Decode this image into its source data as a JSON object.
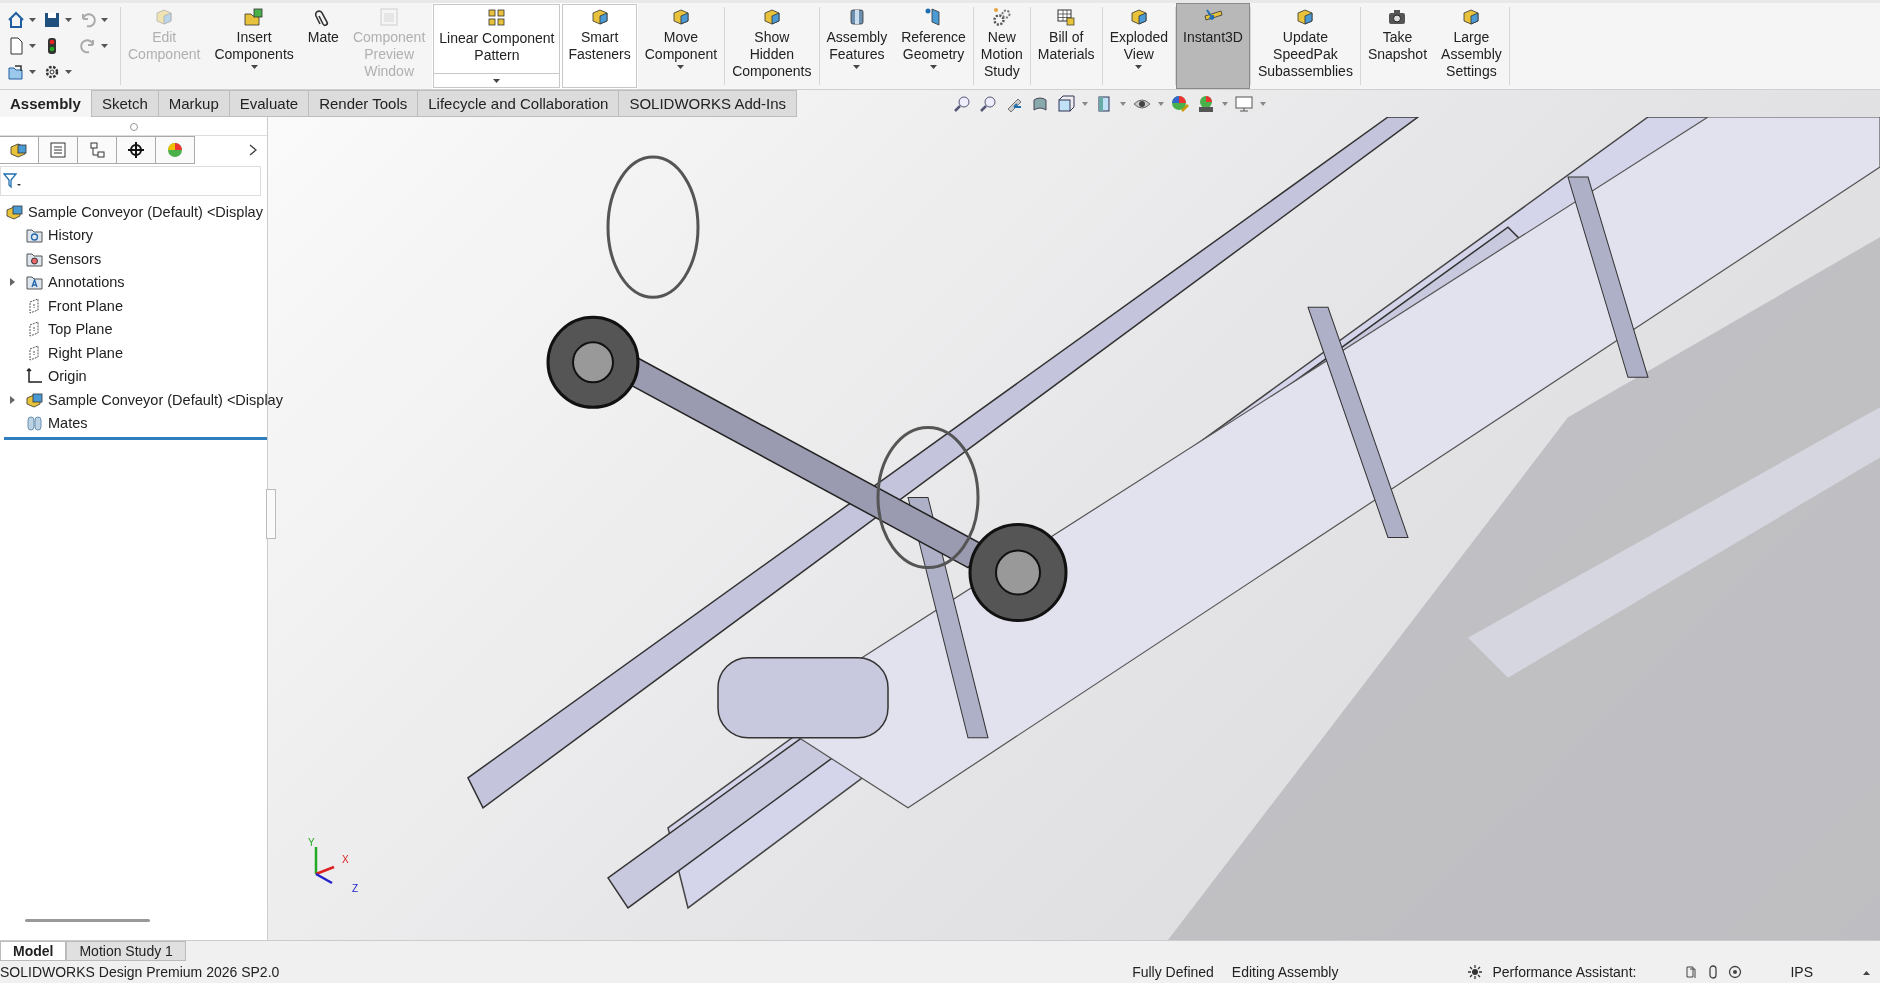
{
  "ribbon": {
    "groups": [
      [
        {
          "lines": [
            "Edit",
            "Component"
          ],
          "kind": "large",
          "dropdown": false,
          "disabled": true,
          "selected": false,
          "framed": false
        },
        {
          "lines": [
            "Insert",
            "Components"
          ],
          "kind": "large",
          "dropdown": true,
          "disabled": false,
          "selected": false,
          "framed": false
        },
        {
          "lines": [
            "Mate"
          ],
          "kind": "large",
          "dropdown": false,
          "disabled": false,
          "selected": false,
          "framed": false
        },
        {
          "lines": [
            "Component",
            "Preview",
            "Window"
          ],
          "kind": "large",
          "dropdown": false,
          "disabled": true,
          "selected": false,
          "framed": false
        },
        {
          "lines": [
            "Linear Component",
            "Pattern"
          ],
          "kind": "split",
          "dropdown": true,
          "disabled": false,
          "selected": false,
          "framed": true
        },
        {
          "lines": [
            "Smart",
            "Fasteners"
          ],
          "kind": "large",
          "dropdown": false,
          "disabled": false,
          "selected": false,
          "framed": true
        },
        {
          "lines": [
            "Move",
            "Component"
          ],
          "kind": "large",
          "dropdown": true,
          "disabled": false,
          "selected": false,
          "framed": false
        }
      ],
      [
        {
          "lines": [
            "Show",
            "Hidden",
            "Components"
          ],
          "kind": "large",
          "dropdown": false,
          "disabled": false,
          "selected": false,
          "framed": false
        }
      ],
      [
        {
          "lines": [
            "Assembly",
            "Features"
          ],
          "kind": "large",
          "dropdown": true,
          "disabled": false,
          "selected": false,
          "framed": false
        },
        {
          "lines": [
            "Reference",
            "Geometry"
          ],
          "kind": "large",
          "dropdown": true,
          "disabled": false,
          "selected": false,
          "framed": false
        }
      ],
      [
        {
          "lines": [
            "New",
            "Motion",
            "Study"
          ],
          "kind": "large",
          "dropdown": false,
          "disabled": false,
          "selected": false,
          "framed": false
        }
      ],
      [
        {
          "lines": [
            "Bill of",
            "Materials"
          ],
          "kind": "large",
          "dropdown": false,
          "disabled": false,
          "selected": false,
          "framed": false
        }
      ],
      [
        {
          "lines": [
            "Exploded",
            "View"
          ],
          "kind": "large",
          "dropdown": true,
          "disabled": false,
          "selected": false,
          "framed": false
        }
      ],
      [
        {
          "lines": [
            "Instant3D"
          ],
          "kind": "large",
          "dropdown": false,
          "disabled": false,
          "selected": true,
          "framed": false
        }
      ],
      [
        {
          "lines": [
            "Update",
            "SpeedPak",
            "Subassemblies"
          ],
          "kind": "large",
          "dropdown": false,
          "disabled": false,
          "selected": false,
          "framed": false
        }
      ],
      [
        {
          "lines": [
            "Take",
            "Snapshot"
          ],
          "kind": "large",
          "dropdown": false,
          "disabled": false,
          "selected": false,
          "framed": false
        },
        {
          "lines": [
            "Large",
            "Assembly",
            "Settings"
          ],
          "kind": "large",
          "dropdown": false,
          "disabled": false,
          "selected": false,
          "framed": false
        }
      ]
    ]
  },
  "tabs": [
    {
      "label": "Assembly",
      "selected": true
    },
    {
      "label": "Sketch",
      "selected": false
    },
    {
      "label": "Markup",
      "selected": false
    },
    {
      "label": "Evaluate",
      "selected": false
    },
    {
      "label": "Render Tools",
      "selected": false
    },
    {
      "label": "Lifecycle and Collaboration",
      "selected": false
    },
    {
      "label": "SOLIDWORKS Add-Ins",
      "selected": false
    }
  ],
  "tree": {
    "label": "Sample Conveyor (Default) <Display",
    "kind": "assembly",
    "children": [
      {
        "label": "History",
        "kind": "history",
        "expandable": false
      },
      {
        "label": "Sensors",
        "kind": "sensors",
        "expandable": false
      },
      {
        "label": "Annotations",
        "kind": "annotations",
        "expandable": true
      },
      {
        "label": "Front Plane",
        "kind": "plane",
        "expandable": false
      },
      {
        "label": "Top Plane",
        "kind": "plane",
        "expandable": false
      },
      {
        "label": "Right Plane",
        "kind": "plane",
        "expandable": false
      },
      {
        "label": "Origin",
        "kind": "origin",
        "expandable": false
      },
      {
        "label": "Sample Conveyor (Default) <Display",
        "kind": "assembly",
        "expandable": true
      },
      {
        "label": "Mates",
        "kind": "mates",
        "expandable": false
      }
    ]
  },
  "triad": {
    "y": "Y",
    "x": "X",
    "z": "Z"
  },
  "bottom_tabs": [
    {
      "label": "Model",
      "selected": true
    },
    {
      "label": "Motion Study 1",
      "selected": false
    }
  ],
  "status_bar": {
    "product": "SOLIDWORKS Design Premium 2026 SP2.0",
    "state": "Fully Defined",
    "mode": "Editing Assembly",
    "assistant": "Performance Assistant:",
    "units": "IPS"
  }
}
